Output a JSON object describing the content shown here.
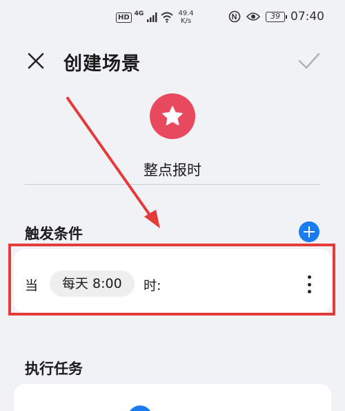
{
  "status_bar": {
    "hd": "HD",
    "network": "4G",
    "speed_value": "49.4",
    "speed_unit": "K/s",
    "battery": "39",
    "time": "07:40"
  },
  "header": {
    "title": "创建场景"
  },
  "scene": {
    "name": "整点报时",
    "icon_color": "#e8495f"
  },
  "trigger": {
    "section_title": "触发条件",
    "prefix": "当",
    "chip": "每天 8:00",
    "suffix": "时:"
  },
  "tasks": {
    "section_title": "执行任务"
  },
  "colors": {
    "accent": "#1a7cf0",
    "annotation": "#e53a3a",
    "background": "#f1f2f6"
  }
}
